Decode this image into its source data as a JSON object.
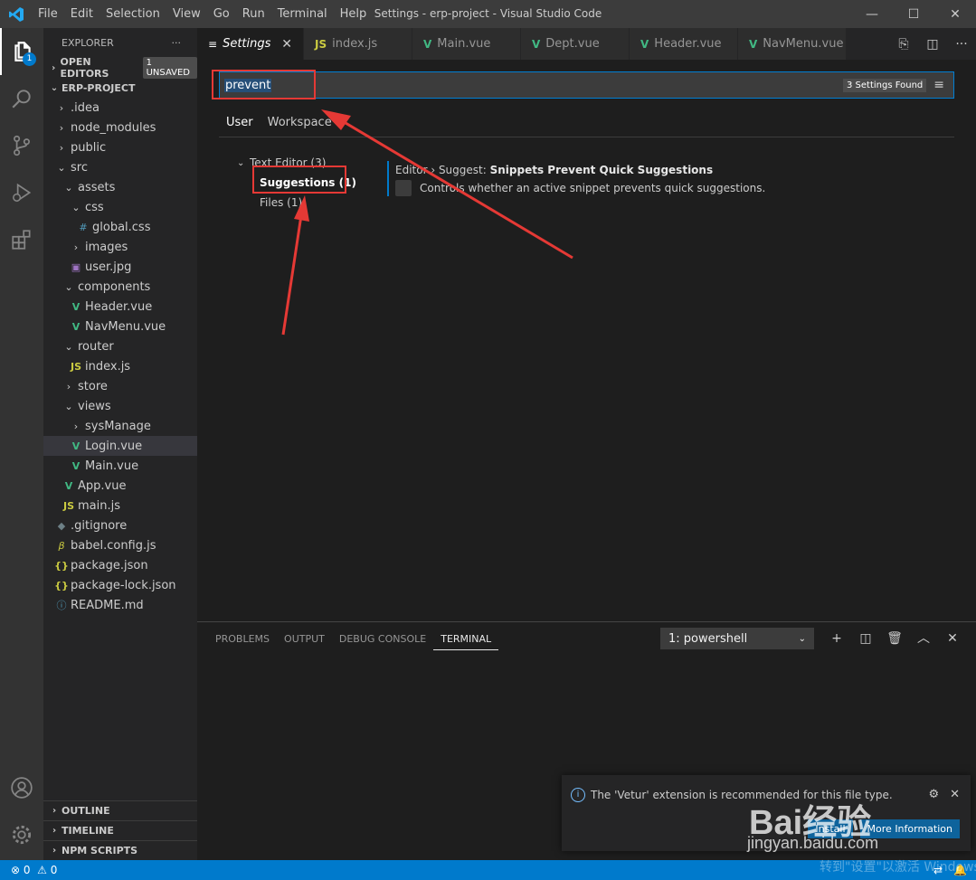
{
  "window": {
    "title": "Settings - erp-project - Visual Studio Code",
    "menu": [
      "File",
      "Edit",
      "Selection",
      "View",
      "Go",
      "Run",
      "Terminal",
      "Help"
    ],
    "controls": {
      "minimize": "—",
      "maximize": "☐",
      "close": "✕"
    }
  },
  "activity": {
    "explorer_badge": "1",
    "icons": [
      "files-icon",
      "search-icon",
      "source-control-icon",
      "run-debug-icon",
      "extensions-icon",
      "account-icon",
      "settings-gear-icon"
    ]
  },
  "sidebar": {
    "title": "EXPLORER",
    "more": "···",
    "open_editors": "OPEN EDITORS",
    "unsaved": "1 UNSAVED",
    "project": "ERP-PROJECT",
    "tree": [
      {
        "label": ".idea",
        "indent": 1,
        "icon": "›",
        "type": "folder"
      },
      {
        "label": "node_modules",
        "indent": 1,
        "icon": "›",
        "type": "folder"
      },
      {
        "label": "public",
        "indent": 1,
        "icon": "›",
        "type": "folder"
      },
      {
        "label": "src",
        "indent": 1,
        "icon": "⌄",
        "type": "folder"
      },
      {
        "label": "assets",
        "indent": 2,
        "icon": "⌄",
        "type": "folder"
      },
      {
        "label": "css",
        "indent": 3,
        "icon": "⌄",
        "type": "folder"
      },
      {
        "label": "global.css",
        "indent": 4,
        "icon": "#",
        "type": "css"
      },
      {
        "label": "images",
        "indent": 3,
        "icon": "›",
        "type": "folder"
      },
      {
        "label": "user.jpg",
        "indent": 3,
        "icon": "▣",
        "type": "img"
      },
      {
        "label": "components",
        "indent": 2,
        "icon": "⌄",
        "type": "folder"
      },
      {
        "label": "Header.vue",
        "indent": 3,
        "icon": "V",
        "type": "vue"
      },
      {
        "label": "NavMenu.vue",
        "indent": 3,
        "icon": "V",
        "type": "vue"
      },
      {
        "label": "router",
        "indent": 2,
        "icon": "⌄",
        "type": "folder"
      },
      {
        "label": "index.js",
        "indent": 3,
        "icon": "JS",
        "type": "js"
      },
      {
        "label": "store",
        "indent": 2,
        "icon": "›",
        "type": "folder"
      },
      {
        "label": "views",
        "indent": 2,
        "icon": "⌄",
        "type": "folder"
      },
      {
        "label": "sysManage",
        "indent": 3,
        "icon": "›",
        "type": "folder"
      },
      {
        "label": "Login.vue",
        "indent": 3,
        "icon": "V",
        "type": "vue",
        "selected": true
      },
      {
        "label": "Main.vue",
        "indent": 3,
        "icon": "V",
        "type": "vue"
      },
      {
        "label": "App.vue",
        "indent": 2,
        "icon": "V",
        "type": "vue"
      },
      {
        "label": "main.js",
        "indent": 2,
        "icon": "JS",
        "type": "js"
      },
      {
        "label": ".gitignore",
        "indent": 1,
        "icon": "◆",
        "type": "git"
      },
      {
        "label": "babel.config.js",
        "indent": 1,
        "icon": "β",
        "type": "babel"
      },
      {
        "label": "package.json",
        "indent": 1,
        "icon": "{}",
        "type": "json"
      },
      {
        "label": "package-lock.json",
        "indent": 1,
        "icon": "{}",
        "type": "json"
      },
      {
        "label": "README.md",
        "indent": 1,
        "icon": "ⓘ",
        "type": "info"
      }
    ],
    "bottom": [
      "OUTLINE",
      "TIMELINE",
      "NPM SCRIPTS"
    ]
  },
  "tabs": [
    {
      "label": "Settings",
      "icon": "≡",
      "active": true,
      "close": "✕"
    },
    {
      "label": "index.js",
      "icon": "JS"
    },
    {
      "label": "Main.vue",
      "icon": "V"
    },
    {
      "label": "Dept.vue",
      "icon": "V"
    },
    {
      "label": "Header.vue",
      "icon": "V"
    },
    {
      "label": "NavMenu.vue",
      "icon": "V"
    }
  ],
  "settings": {
    "search_value": "prevent",
    "found": "3 Settings Found",
    "scope_tabs": [
      "User",
      "Workspace"
    ],
    "toc": {
      "group": "Text Editor (3)",
      "active": "Suggestions (1)",
      "files": "Files (1)"
    },
    "item": {
      "category": "Editor › Suggest: ",
      "name": "Snippets Prevent Quick Suggestions",
      "description": "Controls whether an active snippet prevents quick suggestions."
    }
  },
  "panel": {
    "tabs": [
      "PROBLEMS",
      "OUTPUT",
      "DEBUG CONSOLE",
      "TERMINAL"
    ],
    "terminal": "1: powershell"
  },
  "notification": {
    "message": "The 'Vetur' extension is recommended for this file type.",
    "install": "Install",
    "more": "More Information"
  },
  "statusbar": {
    "errors": "0",
    "warnings": "0"
  },
  "watermark": {
    "logo": "Bai经验",
    "url": "jingyan.baidu.com",
    "activate": "转到\"设置\"以激活 Windows"
  }
}
